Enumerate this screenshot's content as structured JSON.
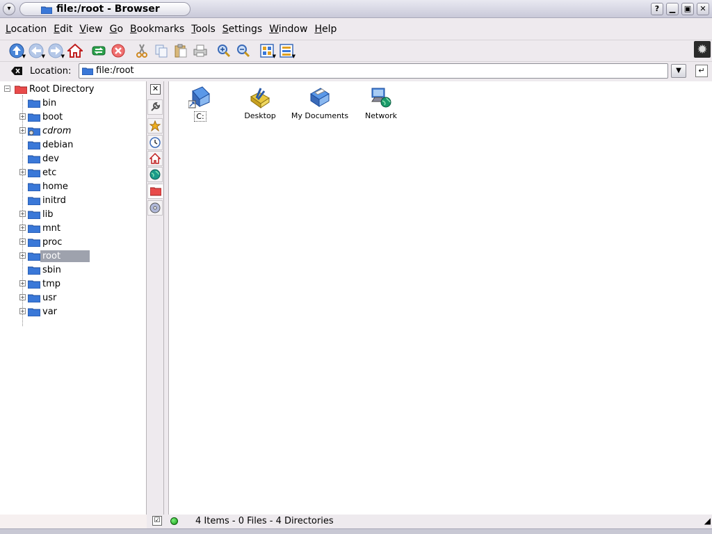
{
  "window": {
    "title": "file:/root - Browser"
  },
  "menu": [
    "Location",
    "Edit",
    "View",
    "Go",
    "Bookmarks",
    "Tools",
    "Settings",
    "Window",
    "Help"
  ],
  "toolbar": {
    "buttons": [
      "up-icon",
      "back-icon",
      "forward-icon",
      "home-icon",
      "reload-icon",
      "stop-icon",
      "cut-icon",
      "copy-icon",
      "paste-icon",
      "print-icon",
      "zoom-in-icon",
      "zoom-out-icon",
      "icon-view-icon",
      "detail-view-icon"
    ]
  },
  "location": {
    "label": "Location:",
    "value": "file:/root"
  },
  "tree": {
    "root_label": "Root Directory",
    "items": [
      {
        "label": "bin",
        "expandable": false
      },
      {
        "label": "boot",
        "expandable": true
      },
      {
        "label": "cdrom",
        "expandable": true,
        "italic": true
      },
      {
        "label": "debian",
        "expandable": false
      },
      {
        "label": "dev",
        "expandable": false
      },
      {
        "label": "etc",
        "expandable": true
      },
      {
        "label": "home",
        "expandable": false
      },
      {
        "label": "initrd",
        "expandable": false
      },
      {
        "label": "lib",
        "expandable": true
      },
      {
        "label": "mnt",
        "expandable": true
      },
      {
        "label": "proc",
        "expandable": true
      },
      {
        "label": "root",
        "expandable": true,
        "selected": true
      },
      {
        "label": "sbin",
        "expandable": false
      },
      {
        "label": "tmp",
        "expandable": true
      },
      {
        "label": "usr",
        "expandable": true
      },
      {
        "label": "var",
        "expandable": true
      }
    ]
  },
  "files": [
    {
      "name": "C:",
      "icon": "drive-link-icon"
    },
    {
      "name": "Desktop",
      "icon": "desktop-folder-icon"
    },
    {
      "name": "My Documents",
      "icon": "documents-folder-icon"
    },
    {
      "name": "Network",
      "icon": "network-icon"
    }
  ],
  "status": {
    "text": "4 Items - 0 Files - 4 Directories"
  },
  "colors": {
    "folder_blue": "#3a78d8",
    "selection": "#9ea2ad"
  }
}
